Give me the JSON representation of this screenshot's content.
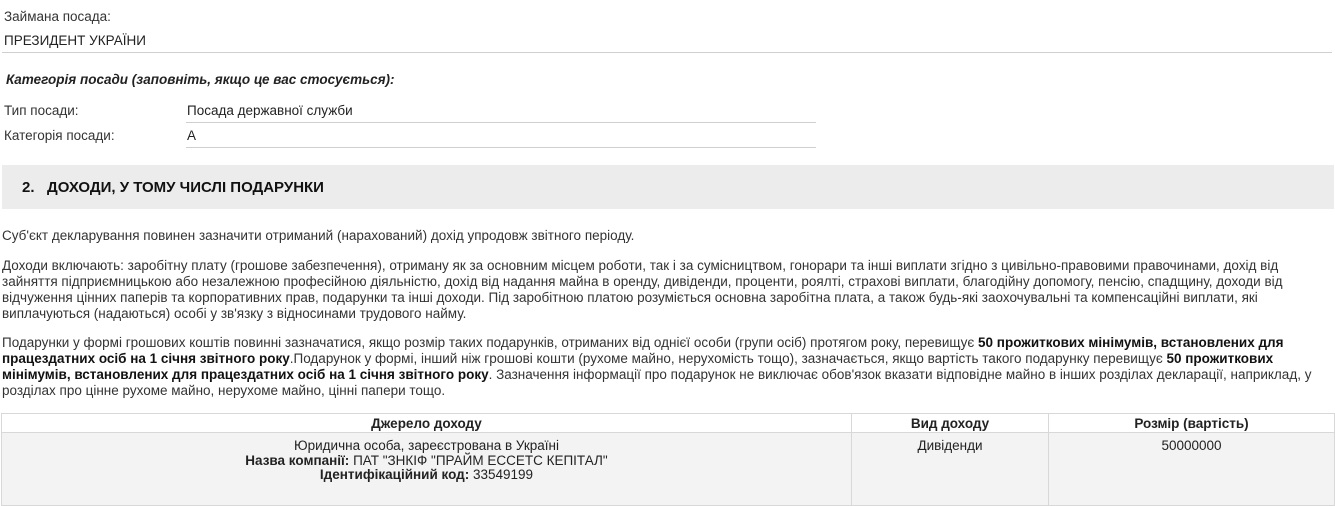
{
  "position": {
    "label": "Займана посада:",
    "value": "ПРЕЗИДЕНТ УКРАЇНИ"
  },
  "category": {
    "title": "Категорія посади (заповніть, якщо це вас стосується):",
    "type_label": "Тип посади:",
    "type_value": "Посада державної служби",
    "cat_label": "Категорія посади:",
    "cat_value": "А"
  },
  "section": {
    "number": "2.",
    "title": "ДОХОДИ, У ТОМУ ЧИСЛІ ПОДАРУНКИ"
  },
  "paragraphs": {
    "p1": "Суб'єкт декларування повинен зазначити отриманий (нарахований) дохід упродовж звітного періоду.",
    "p2": "Доходи включають: заробітну плату (грошове забезпечення), отриману як за основним місцем роботи, так і за сумісництвом, гонорари та інші виплати згідно з цивільно-правовими правочинами, дохід від зайняття підприємницькою або незалежною професійною діяльністю, дохід від надання майна в оренду, дивіденди, проценти, роялті, страхові виплати, благодійну допомогу, пенсію, спадщину, доходи від відчуження цінних паперів та корпоративних прав, подарунки та інші доходи. Під заробітною платою розуміється основна заробітна плата, а також будь-які заохочувальні та компенсаційні виплати, які виплачуються (надаються) особі у зв'язку з відносинами трудового найму.",
    "p3_a": "Подарунки у формі грошових коштів повинні зазначатися, якщо розмір таких подарунків, отриманих від однієї особи (групи осіб) протягом року, перевищує ",
    "p3_b": "50 прожиткових мінімумів, встановлених для працездатних осіб на 1 січня звітного року",
    "p3_c": ".Подарунок у формі, інший ніж грошові кошти (рухоме майно, нерухомість тощо), зазначається, якщо вартість такого подарунку перевищує ",
    "p3_d": "50 прожиткових мінімумів, встановлених для працездатних осіб на 1 січня звітного року",
    "p3_e": ". Зазначення інформації про подарунок не виключає обов'язок вказати відповідне майно в інших розділах декларації, наприклад, у розділах про цінне рухоме майно, нерухоме майно, цінні папери тощо."
  },
  "table": {
    "headers": [
      "Джерело доходу",
      "Вид доходу",
      "Розмір (вартість)"
    ],
    "row": {
      "source_line1": "Юридична особа, зареєстрована в Україні",
      "company_label": "Назва компанії:",
      "company_value": "ПАТ \"ЗНКІФ \"ПРАЙМ ЕССЕТС КЕПІТАЛ\"",
      "code_label": "Ідентифікаційний код:",
      "code_value": "33549199",
      "type": "Дивіденди",
      "amount": "50000000"
    }
  }
}
